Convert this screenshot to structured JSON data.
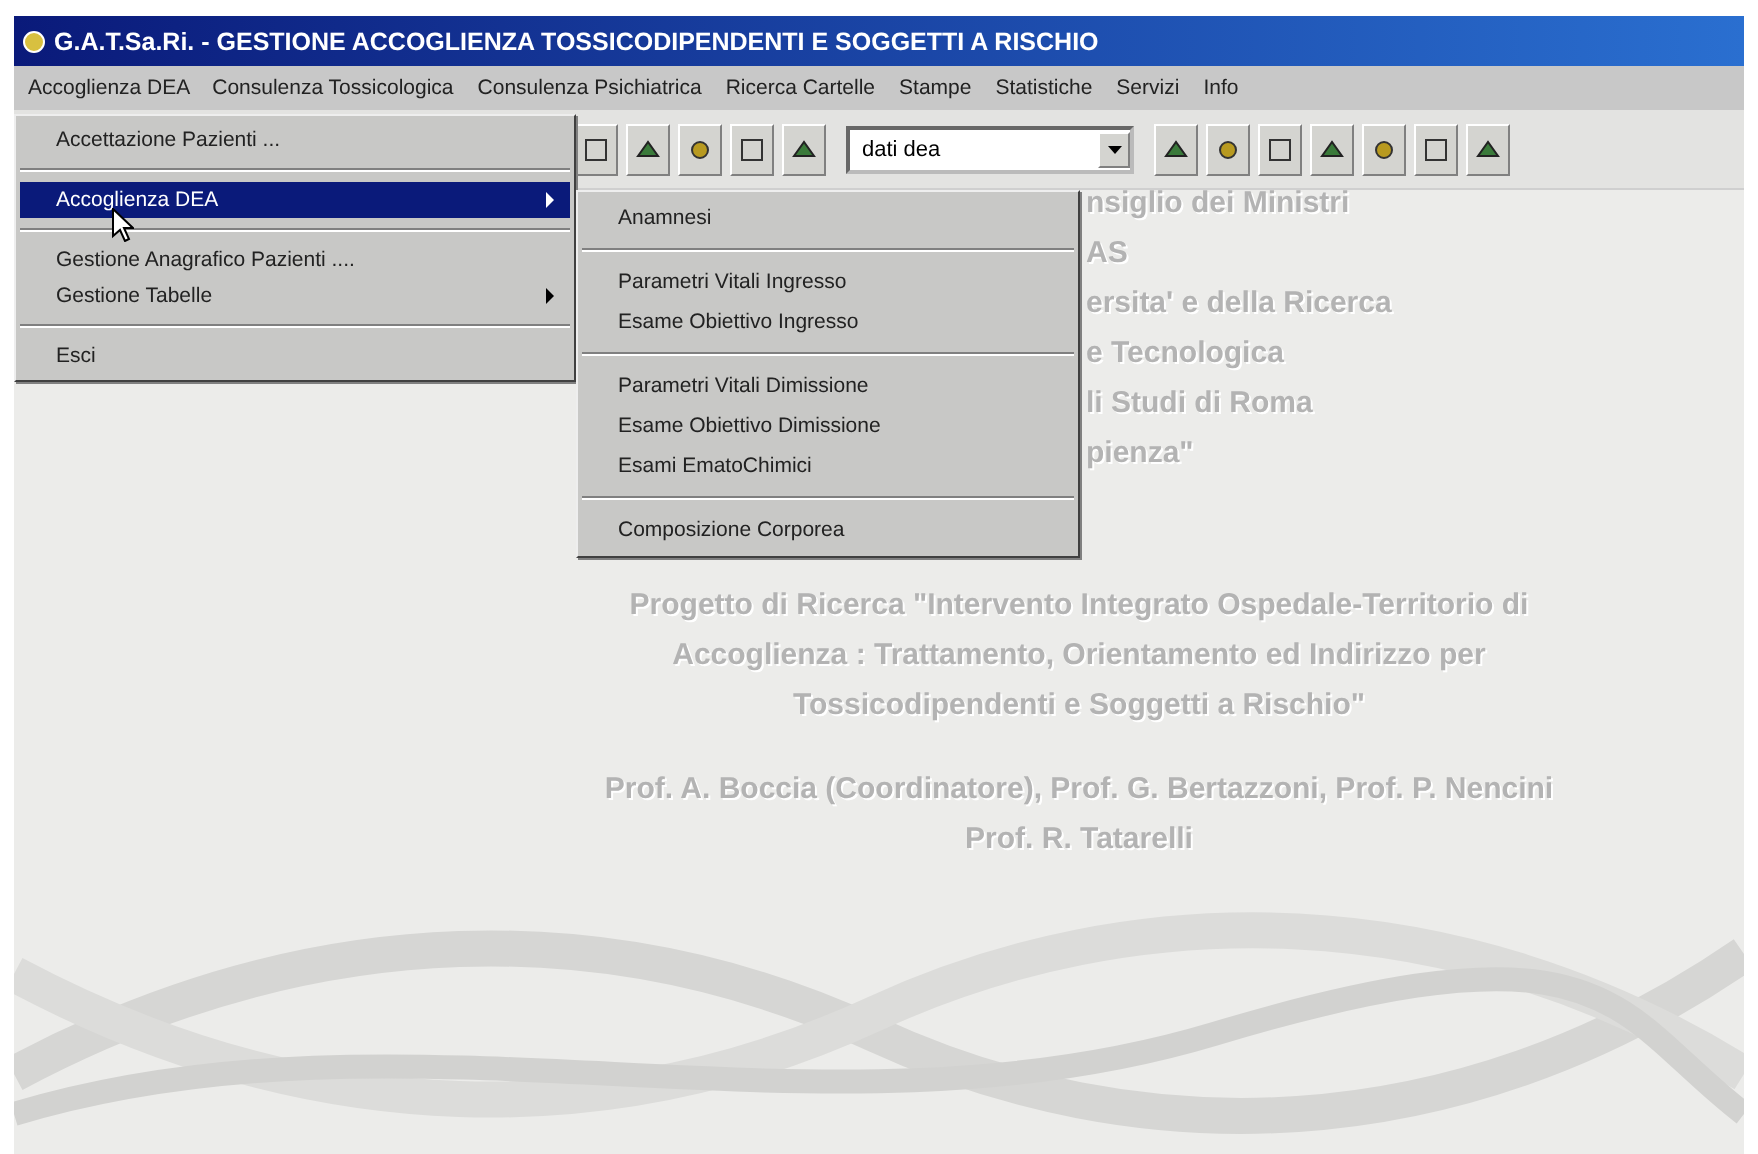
{
  "window": {
    "title": "G.A.T.Sa.Ri. - GESTIONE ACCOGLIENZA TOSSICODIPENDENTI E SOGGETTI A RISCHIO"
  },
  "menu_bar": [
    {
      "label": "Accoglienza DEA",
      "selected": true
    },
    {
      "label": "Consulenza Tossicologica",
      "selected": false
    },
    {
      "label": "Consulenza Psichiatrica",
      "selected": false
    },
    {
      "label": "Ricerca Cartelle",
      "selected": false
    },
    {
      "label": "Stampe",
      "selected": false
    },
    {
      "label": "Statistiche",
      "selected": false
    },
    {
      "label": "Servizi",
      "selected": false
    },
    {
      "label": "Info",
      "selected": false
    }
  ],
  "toolbar": {
    "combo": {
      "value": "dati dea"
    }
  },
  "menu": [
    {
      "kind": "item",
      "label": "Accettazione Pazienti ...",
      "selected": false,
      "submenu": false
    },
    {
      "kind": "separator"
    },
    {
      "kind": "item",
      "label": "Accoglienza DEA",
      "selected": true,
      "submenu": true
    },
    {
      "kind": "separator"
    },
    {
      "kind": "item",
      "label": "Gestione Anagrafico Pazienti ....",
      "selected": false,
      "submenu": false
    },
    {
      "kind": "item",
      "label": "Gestione Tabelle",
      "selected": false,
      "submenu": true
    },
    {
      "kind": "separator"
    },
    {
      "kind": "item",
      "label": "Esci",
      "selected": false,
      "submenu": false
    }
  ],
  "submenu": [
    {
      "kind": "item",
      "label": "Anamnesi"
    },
    {
      "kind": "separator"
    },
    {
      "kind": "item",
      "label": "Parametri Vitali Ingresso"
    },
    {
      "kind": "item",
      "label": "Esame Obiettivo Ingresso"
    },
    {
      "kind": "separator"
    },
    {
      "kind": "item",
      "label": "Parametri Vitali Dimissione"
    },
    {
      "kind": "item",
      "label": "Esame Obiettivo Dimissione"
    },
    {
      "kind": "item",
      "label": "Esami EmatoChimici"
    },
    {
      "kind": "separator"
    },
    {
      "kind": "item",
      "label": "Composizione Corporea"
    }
  ],
  "body": {
    "partial_lines": [
      "nsiglio dei Ministri",
      "AS",
      "ersita' e della Ricerca",
      "e Tecnologica",
      "li Studi di Roma",
      "pienza\""
    ],
    "lines": [
      "Progetto di Ricerca \"Intervento Integrato Ospedale-Territorio di",
      "Accoglienza : Trattamento, Orientamento ed Indirizzo per",
      "Tossicodipendenti e Soggetti a Rischio\""
    ],
    "credits": [
      "Prof. A. Boccia (Coordinatore), Prof. G. Bertazzoni, Prof. P. Nencini",
      "Prof. R. Tatarelli"
    ]
  }
}
